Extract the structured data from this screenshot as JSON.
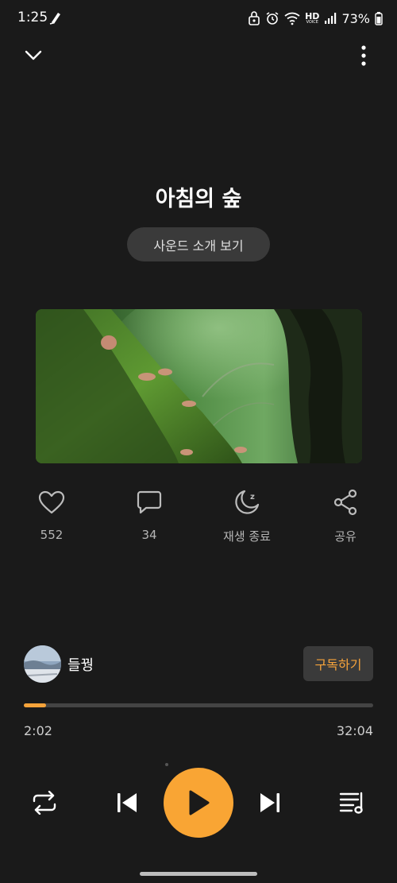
{
  "status_bar": {
    "time": "1:25",
    "battery": "73%",
    "network_badge_top": "HD",
    "network_badge_bottom": "VOICE"
  },
  "track": {
    "title": "아침의 숲",
    "intro_button": "사운드 소개 보기"
  },
  "actions": [
    {
      "icon": "heart-icon",
      "label": "552"
    },
    {
      "icon": "comment-icon",
      "label": "34"
    },
    {
      "icon": "moon-icon",
      "label": "재생 종료"
    },
    {
      "icon": "share-icon",
      "label": "공유"
    }
  ],
  "creator": {
    "name": "들꿩",
    "subscribe_label": "구독하기"
  },
  "progress": {
    "elapsed": "2:02",
    "duration": "32:04",
    "fraction": 0.0635
  },
  "colors": {
    "background": "#1a1a1a",
    "accent": "#f9a534",
    "subscribe_text": "#f6a33a"
  }
}
